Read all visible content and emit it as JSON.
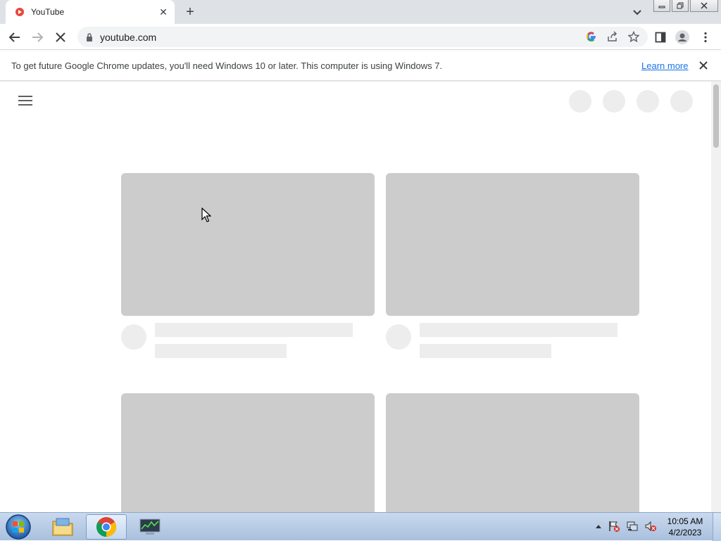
{
  "browser": {
    "tab": {
      "title": "YouTube"
    },
    "address": {
      "url": "youtube.com"
    }
  },
  "infobar": {
    "message": "To get future Google Chrome updates, you'll need Windows 10 or later. This computer is using Windows 7.",
    "link_label": "Learn more"
  },
  "taskbar": {
    "time": "10:05 AM",
    "date": "4/2/2023",
    "apps": [
      "windows-explorer",
      "google-chrome",
      "task-manager"
    ]
  },
  "colors": {
    "placeholder_thumb": "#cccccc",
    "placeholder_light": "#ededed",
    "link": "#1a73e8",
    "tabstrip": "#dee1e6"
  }
}
